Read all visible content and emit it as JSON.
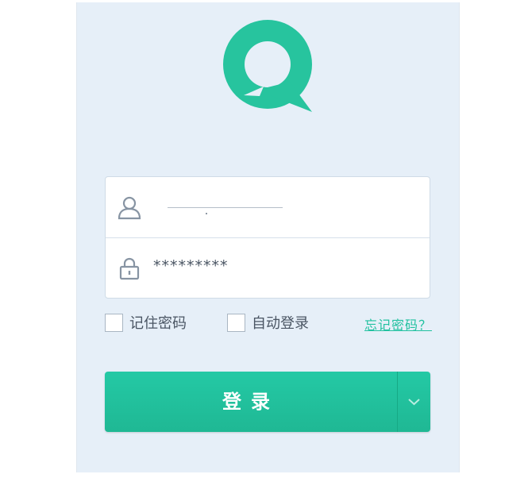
{
  "login": {
    "username_value": "",
    "password_value": "*********",
    "remember_label": "记住密码",
    "auto_login_label": "自动登录",
    "forgot_label": "忘记密码？",
    "submit_label": "登录"
  },
  "icons": {
    "logo": "speech-bubble-logo",
    "username": "user-icon",
    "password": "lock-icon",
    "dropdown": "chevron-down-icon"
  },
  "colors": {
    "brand": "#22c19f",
    "panel_background": "#e6eff8",
    "button": "#1fbf9a"
  }
}
